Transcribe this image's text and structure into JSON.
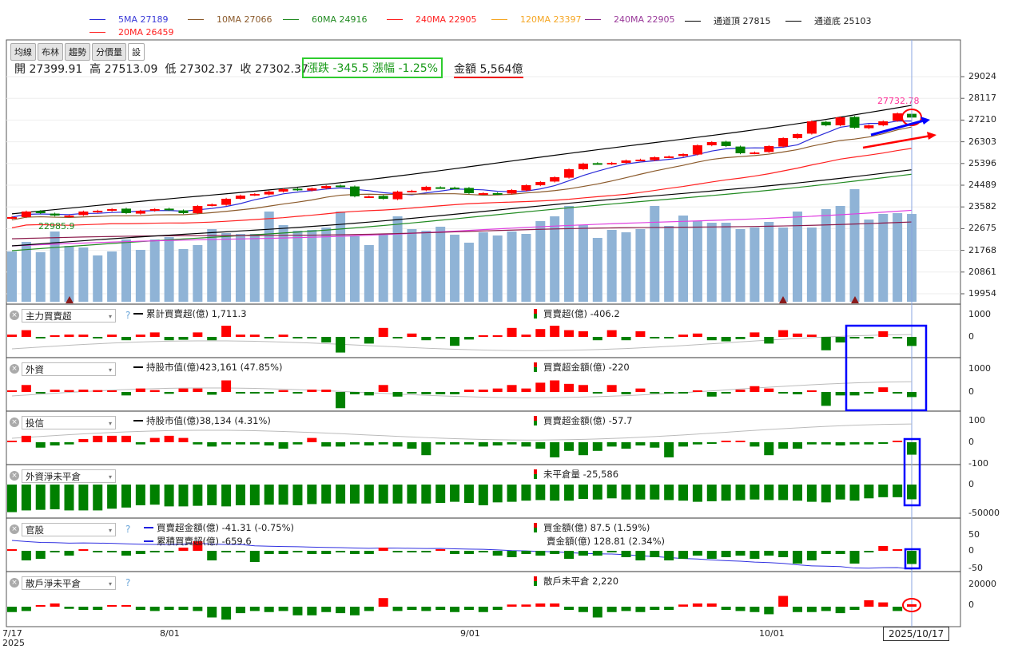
{
  "legend": [
    {
      "label": "5MA 27189",
      "color": "#2b2bd8"
    },
    {
      "label": "10MA 27066",
      "color": "#8b5a2b"
    },
    {
      "label": "60MA 24916",
      "color": "#228b22"
    },
    {
      "label": "240MA 22905",
      "color": "#ff2020"
    },
    {
      "label": "120MA 23397",
      "color": "#f5a623"
    },
    {
      "label": "240MA 22905",
      "color": "#8b2a8b"
    },
    {
      "label": "通道頂 27815",
      "color": "#000000"
    },
    {
      "label": "通道底 25103",
      "color": "#000000"
    },
    {
      "label": "20MA 26459",
      "color": "#ff2020"
    }
  ],
  "toolbar": [
    "均線",
    "布林",
    "趨勢",
    "分價量",
    "設"
  ],
  "quote": {
    "open_label": "開",
    "open": "27399.91",
    "high_label": "高",
    "high": "27513.09",
    "low_label": "低",
    "low": "27302.37",
    "close_label": "收",
    "close": "27302.37"
  },
  "change": "漲跌 -345.5  漲幅   -1.25%",
  "amount": "金額 5,564億",
  "price_axis": [
    "29024",
    "28117",
    "27210",
    "26303",
    "25396",
    "24489",
    "23582",
    "22675",
    "21768",
    "20861",
    "19954"
  ],
  "annotations": {
    "high_marker": "27732.78",
    "low_marker": "22985.9"
  },
  "panels": [
    {
      "select": "主力買賣超",
      "help": "?",
      "line_label": "累計買賣超(億) 1,711.3",
      "bar_label": "買賣超(億) -406.2",
      "axis": [
        "1000",
        "0"
      ]
    },
    {
      "select": "外資",
      "line_label": "持股市值(億)423,161 (47.85%)",
      "bar_label": "買賣超金額(億) -220",
      "axis": [
        "1000",
        "0"
      ]
    },
    {
      "select": "投信",
      "line_label": "持股市值(億)38,134 (4.31%)",
      "bar_label": "買賣超金額(億) -57.7",
      "axis": [
        "100",
        "0",
        "-100"
      ]
    },
    {
      "select": "外資淨未平倉",
      "bar_label": "未平倉量 -25,586",
      "axis": [
        "0",
        "-50000"
      ]
    },
    {
      "select": "官股",
      "help": "?",
      "line_label": "買賣超金額(億) -41.31 (-0.75%)",
      "line_label2": "累積買賣超(億) -659.6",
      "bar_label": "買金額(億) 87.5 (1.59%)",
      "bar_label2": "賣金額(億) 128.81 (2.34%)",
      "axis": [
        "50",
        "0",
        "-50"
      ]
    },
    {
      "select": "散戶淨未平倉",
      "help": "?",
      "bar_label": "散戶未平倉 2,220",
      "axis": [
        "20000",
        "0"
      ]
    }
  ],
  "x_axis": {
    "dates": [
      "7/17",
      "8/01",
      "9/01",
      "10/01"
    ],
    "year": "2025",
    "cursor_date": "2025/10/17"
  },
  "colors": {
    "up": "#ff0000",
    "down": "#008000",
    "volume": "#8fb3d6",
    "cursor": "#8aa6e0",
    "annot_blue": "#0000ff",
    "annot_red": "#ff0000"
  },
  "chart_data": {
    "type": "candlestick",
    "close": [
      23111,
      23346,
      23279,
      23178,
      23178,
      23346,
      23380,
      23447,
      23279,
      23380,
      23447,
      23413,
      23279,
      23581,
      23648,
      23884,
      24018,
      24085,
      24186,
      24287,
      24253,
      24320,
      24421,
      24421,
      23984,
      23984,
      23884,
      24186,
      24220,
      24388,
      24354,
      24320,
      24119,
      24119,
      24085,
      24253,
      24455,
      24589,
      24791,
      25127,
      25362,
      25362,
      25396,
      25496,
      25530,
      25631,
      25665,
      25765,
      26135,
      26269,
      26101,
      25799,
      25832,
      26101,
      26437,
      26605,
      27143,
      26975,
      27311,
      26874,
      26975,
      27143,
      27479,
      27302
    ],
    "volume": [
      3188,
      3795,
      3137,
      4453,
      3542,
      3441,
      2935,
      3188,
      3947,
      3289,
      3947,
      4099,
      3340,
      3593,
      4605,
      4352,
      4301,
      4301,
      5718,
      4858,
      4503,
      4554,
      4706,
      5718,
      4149,
      3593,
      4301,
      5414,
      4605,
      4503,
      4756,
      4250,
      3744,
      4402,
      4200,
      4453,
      4301,
      5111,
      5414,
      6072,
      4858,
      4048,
      4554,
      4402,
      4605,
      6072,
      4807,
      5465,
      5111,
      5009,
      5009,
      4605,
      4706,
      5060,
      4706,
      5718,
      4706,
      5870,
      6072,
      7135,
      5212,
      5566,
      5616,
      5564
    ],
    "lines": [
      {
        "name": "60MA",
        "start": 21700,
        "end": 24916,
        "color": "#228b22"
      },
      {
        "name": "120MA",
        "start": 21900,
        "end": 23397,
        "color": "#e040e0"
      },
      {
        "name": "240MA",
        "start": 22200,
        "end": 22905,
        "color": "#8b1a4a"
      },
      {
        "name": "通道頂",
        "start": 23250,
        "end": 27815,
        "color": "#000000"
      },
      {
        "name": "通道底",
        "start": 21900,
        "end": 25103,
        "color": "#000000"
      }
    ],
    "panels": [
      [
        100,
        300,
        -30,
        0,
        100,
        100,
        -60,
        100,
        -150,
        100,
        200,
        -150,
        -130,
        200,
        -150,
        500,
        100,
        100,
        -20,
        100,
        -60,
        -60,
        -250,
        -700,
        -30,
        -300,
        400,
        -30,
        150,
        -150,
        -80,
        -400,
        -120,
        60,
        60,
        400,
        100,
        350,
        500,
        300,
        250,
        -150,
        300,
        -150,
        250,
        -30,
        -40,
        100,
        150,
        -150,
        -200,
        -100,
        200,
        -300,
        300,
        150,
        100,
        -600,
        -250,
        -30,
        -30,
        250,
        -30,
        -406.2
      ],
      [
        0,
        300,
        -60,
        100,
        80,
        100,
        80,
        60,
        -150,
        150,
        80,
        -80,
        150,
        150,
        -120,
        500,
        -20,
        -20,
        -60,
        80,
        -30,
        100,
        100,
        -700,
        -100,
        -150,
        300,
        -200,
        -20,
        -100,
        -100,
        -100,
        100,
        100,
        150,
        300,
        150,
        400,
        500,
        350,
        300,
        -30,
        300,
        -100,
        150,
        -60,
        -60,
        -30,
        50,
        -200,
        -50,
        100,
        250,
        150,
        -30,
        -100,
        50,
        -600,
        -150,
        -150,
        -50,
        200,
        -30,
        -220
      ],
      [
        0,
        30,
        -25,
        -15,
        -10,
        15,
        30,
        30,
        30,
        -10,
        20,
        30,
        20,
        -10,
        -20,
        -10,
        -10,
        -10,
        -15,
        -30,
        -10,
        20,
        -20,
        -20,
        -10,
        -15,
        -10,
        -20,
        -30,
        -60,
        -10,
        -10,
        -10,
        -20,
        -15,
        -10,
        -20,
        -30,
        -70,
        -40,
        -60,
        -40,
        -20,
        -30,
        -15,
        -25,
        -70,
        -20,
        -10,
        -5,
        2,
        2,
        -20,
        -60,
        -30,
        -30,
        -10,
        -10,
        -15,
        -10,
        -10,
        -5,
        2,
        -57.7
      ],
      [
        -48000,
        -45000,
        -44000,
        -43000,
        -45000,
        -45000,
        -45000,
        -42000,
        -40000,
        -36000,
        -35000,
        -38000,
        -38000,
        -37000,
        -36000,
        -38000,
        -36000,
        -36000,
        -35000,
        -35000,
        -36000,
        -34000,
        -33000,
        -33000,
        -33000,
        -33000,
        -33000,
        -33000,
        -33000,
        -33000,
        -32000,
        -30000,
        -32000,
        -36000,
        -31000,
        -30000,
        -28000,
        -27000,
        -28000,
        -28000,
        -25000,
        -26000,
        -24000,
        -26000,
        -26000,
        -26000,
        -27000,
        -28000,
        -30000,
        -29000,
        -28000,
        -27000,
        -26000,
        -27000,
        -27000,
        -28000,
        -30000,
        -31000,
        -26000,
        -28000,
        -24000,
        -22000,
        -22000,
        -25586
      ],
      [
        0,
        -30,
        -25,
        -5,
        -15,
        5,
        -5,
        -5,
        -15,
        -10,
        -5,
        -5,
        10,
        30,
        -30,
        -5,
        -5,
        -35,
        -10,
        -10,
        -5,
        -10,
        -10,
        -5,
        -10,
        -10,
        10,
        -5,
        -5,
        -5,
        2,
        -10,
        -10,
        -5,
        -15,
        -20,
        -10,
        -15,
        -10,
        -25,
        -15,
        -15,
        -5,
        -20,
        -30,
        -20,
        -30,
        -25,
        -15,
        -25,
        -20,
        -15,
        -25,
        -15,
        -20,
        -40,
        -30,
        -10,
        -10,
        -40,
        -5,
        15,
        2,
        -41.31
      ],
      [
        -5000,
        -4000,
        0,
        3000,
        -2000,
        -3000,
        -3000,
        0,
        0,
        -3000,
        -4000,
        -3000,
        -3000,
        -4000,
        -10000,
        -12000,
        -6000,
        -4000,
        -5000,
        -4000,
        -8000,
        -8000,
        -5000,
        -6000,
        -8000,
        -4000,
        8000,
        -4000,
        -3000,
        -4000,
        -3000,
        -5000,
        -3000,
        -5000,
        -3000,
        2000,
        2000,
        3000,
        3000,
        -3000,
        -5000,
        -10000,
        -5000,
        -4000,
        -5000,
        -3000,
        -3000,
        2000,
        3000,
        3000,
        -3000,
        -4000,
        -5000,
        -7000,
        10000,
        -5000,
        -5000,
        -4000,
        -6000,
        -3000,
        6000,
        4000,
        -4000,
        2220
      ]
    ]
  }
}
